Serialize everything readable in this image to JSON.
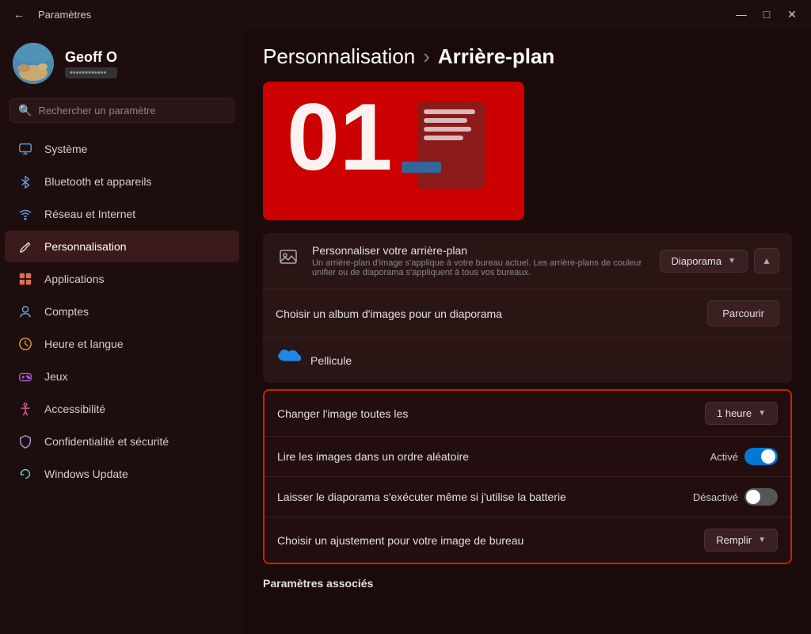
{
  "titlebar": {
    "title": "Paramètres",
    "back_label": "←",
    "minimize": "—",
    "maximize": "□",
    "close": "✕"
  },
  "sidebar": {
    "user": {
      "name": "Geoff O",
      "account_placeholder": "••••••••••••••"
    },
    "search_placeholder": "Rechercher un paramètre",
    "items": [
      {
        "id": "systeme",
        "label": "Système",
        "icon": "monitor"
      },
      {
        "id": "bluetooth",
        "label": "Bluetooth et appareils",
        "icon": "bluetooth"
      },
      {
        "id": "reseau",
        "label": "Réseau et Internet",
        "icon": "wifi"
      },
      {
        "id": "personnalisation",
        "label": "Personnalisation",
        "icon": "brush",
        "active": true
      },
      {
        "id": "applications",
        "label": "Applications",
        "icon": "apps"
      },
      {
        "id": "comptes",
        "label": "Comptes",
        "icon": "user"
      },
      {
        "id": "heure",
        "label": "Heure et langue",
        "icon": "clock"
      },
      {
        "id": "jeux",
        "label": "Jeux",
        "icon": "gamepad"
      },
      {
        "id": "accessibilite",
        "label": "Accessibilité",
        "icon": "accessibility"
      },
      {
        "id": "confidentialite",
        "label": "Confidentialité et sécurité",
        "icon": "shield"
      },
      {
        "id": "windows-update",
        "label": "Windows Update",
        "icon": "refresh"
      }
    ]
  },
  "content": {
    "breadcrumb_parent": "Personnalisation",
    "breadcrumb_sep": ">",
    "breadcrumb_current": "Arrière-plan",
    "personnaliser_label": "Personnaliser votre arrière-plan",
    "personnaliser_desc": "Un arrière-plan d'image s'applique à votre bureau actuel. Les arrière-plans de couleur unifier ou de diaporama s'appliquent à tous vos bureaux.",
    "personnaliser_value": "Diaporama",
    "album_label": "Choisir un album d'images pour un diaporama",
    "album_btn": "Parcourir",
    "onedrive_label": "Pellicule",
    "changer_label": "Changer l'image toutes les",
    "changer_value": "1 heure",
    "lire_label": "Lire les images dans un ordre aléatoire",
    "lire_status": "Activé",
    "laisser_label": "Laisser le diaporama s'exécuter même si j'utilise la batterie",
    "laisser_status": "Désactivé",
    "choisir_label": "Choisir un ajustement pour votre image de bureau",
    "choisir_value": "Remplir",
    "parametres_associes": "Paramètres associés"
  }
}
